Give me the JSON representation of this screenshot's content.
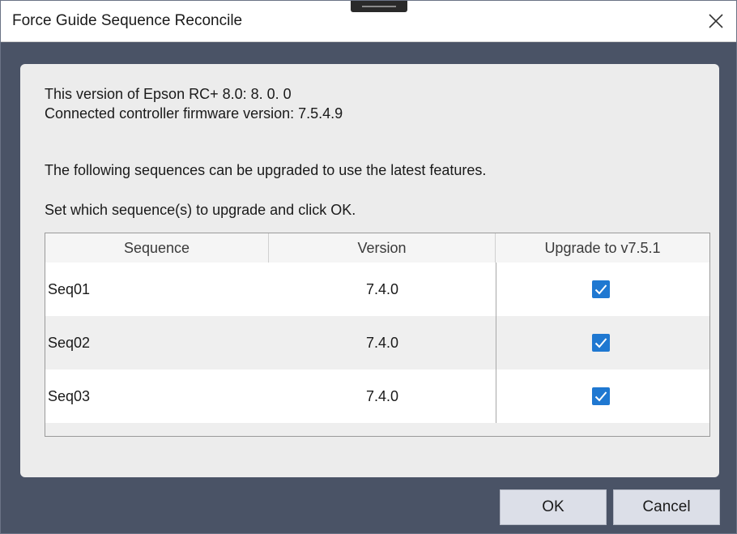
{
  "window": {
    "title": "Force Guide Sequence Reconcile"
  },
  "info": {
    "version_line": "This version of Epson RC+ 8.0: 8. 0. 0",
    "firmware_line": "Connected controller firmware version: 7.5.4.9",
    "following_line": "The following sequences can be upgraded to use the latest features.",
    "instruction_line": "Set which sequence(s) to upgrade and click OK."
  },
  "table": {
    "columns": [
      "Sequence",
      "Version",
      "Upgrade to v7.5.1"
    ],
    "rows": [
      {
        "sequence": "Seq01",
        "version": "7.4.0",
        "upgrade": true
      },
      {
        "sequence": "Seq02",
        "version": "7.4.0",
        "upgrade": true
      },
      {
        "sequence": "Seq03",
        "version": "7.4.0",
        "upgrade": true
      }
    ]
  },
  "buttons": {
    "ok_label": "OK",
    "cancel_label": "Cancel"
  },
  "icons": {
    "close": "close-icon",
    "check": "check-icon"
  },
  "colors": {
    "checkbox_accent": "#1f78d1",
    "frame_background": "#4a5366"
  }
}
